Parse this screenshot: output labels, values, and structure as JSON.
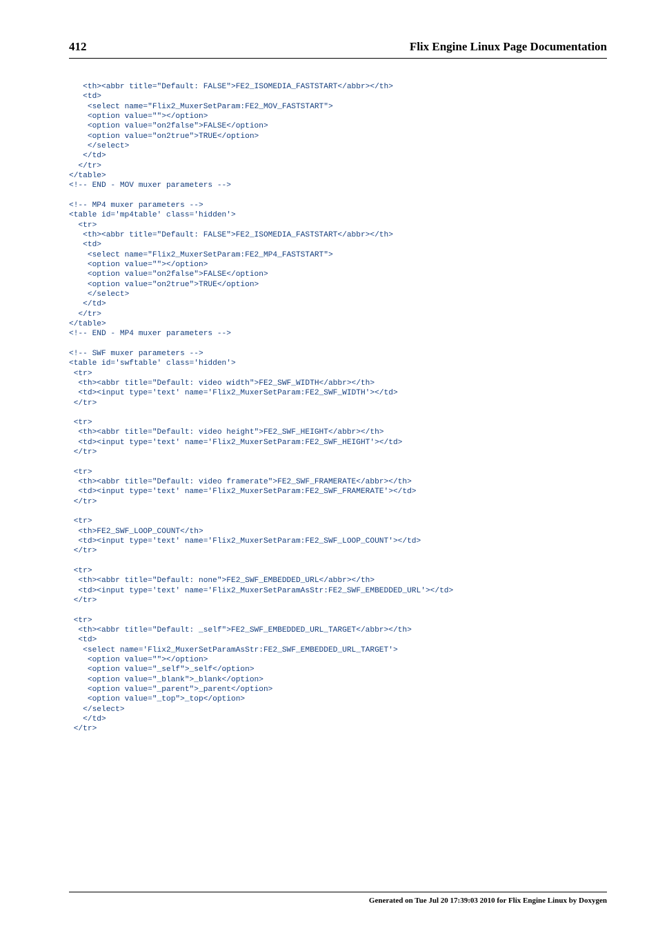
{
  "header": {
    "page_number": "412",
    "title": "Flix Engine Linux Page Documentation"
  },
  "code": "   <th><abbr title=\"Default: FALSE\">FE2_ISOMEDIA_FASTSTART</abbr></th>\n   <td>\n    <select name=\"Flix2_MuxerSetParam:FE2_MOV_FASTSTART\">\n    <option value=\"\"></option>\n    <option value=\"on2false\">FALSE</option>\n    <option value=\"on2true\">TRUE</option>\n    </select>\n   </td>\n  </tr>\n</table>\n<!-- END - MOV muxer parameters -->\n\n<!-- MP4 muxer parameters -->\n<table id='mp4table' class='hidden'>\n  <tr>\n   <th><abbr title=\"Default: FALSE\">FE2_ISOMEDIA_FASTSTART</abbr></th>\n   <td>\n    <select name=\"Flix2_MuxerSetParam:FE2_MP4_FASTSTART\">\n    <option value=\"\"></option>\n    <option value=\"on2false\">FALSE</option>\n    <option value=\"on2true\">TRUE</option>\n    </select>\n   </td>\n  </tr>\n</table>\n<!-- END - MP4 muxer parameters -->\n\n<!-- SWF muxer parameters -->\n<table id='swftable' class='hidden'>\n <tr>\n  <th><abbr title=\"Default: video width\">FE2_SWF_WIDTH</abbr></th>\n  <td><input type='text' name='Flix2_MuxerSetParam:FE2_SWF_WIDTH'></td>\n </tr>\n\n <tr>\n  <th><abbr title=\"Default: video height\">FE2_SWF_HEIGHT</abbr></th>\n  <td><input type='text' name='Flix2_MuxerSetParam:FE2_SWF_HEIGHT'></td>\n </tr>\n\n <tr>\n  <th><abbr title=\"Default: video framerate\">FE2_SWF_FRAMERATE</abbr></th>\n  <td><input type='text' name='Flix2_MuxerSetParam:FE2_SWF_FRAMERATE'></td>\n </tr>\n\n <tr>\n  <th>FE2_SWF_LOOP_COUNT</th>\n  <td><input type='text' name='Flix2_MuxerSetParam:FE2_SWF_LOOP_COUNT'></td>\n </tr>\n\n <tr>\n  <th><abbr title=\"Default: none\">FE2_SWF_EMBEDDED_URL</abbr></th>\n  <td><input type='text' name='Flix2_MuxerSetParamAsStr:FE2_SWF_EMBEDDED_URL'></td>\n </tr>\n\n <tr>\n  <th><abbr title=\"Default: _self\">FE2_SWF_EMBEDDED_URL_TARGET</abbr></th>\n  <td>\n   <select name='Flix2_MuxerSetParamAsStr:FE2_SWF_EMBEDDED_URL_TARGET'>\n    <option value=\"\"></option>\n    <option value=\"_self\">_self</option>\n    <option value=\"_blank\">_blank</option>\n    <option value=\"_parent\">_parent</option>\n    <option value=\"_top\">_top</option>\n   </select>\n   </td>\n </tr>",
  "footer": "Generated on Tue Jul 20 17:39:03 2010 for Flix Engine Linux by Doxygen"
}
